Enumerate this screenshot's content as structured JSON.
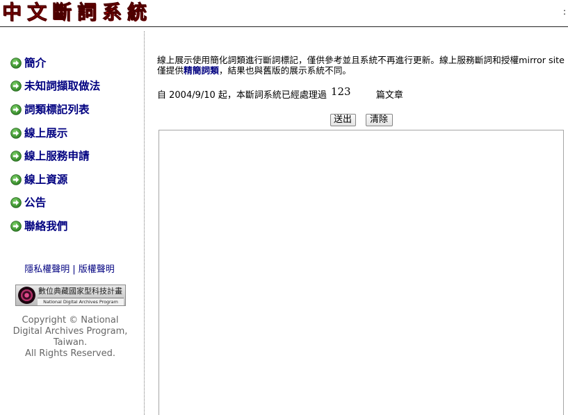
{
  "header": {
    "title": "中文斷詞系統",
    "corner_text": ":"
  },
  "sidebar": {
    "nav_icon": "green-arrow-circle-icon",
    "items": [
      {
        "label": "簡介"
      },
      {
        "label": "未知詞擷取做法"
      },
      {
        "label": "詞類標記列表"
      },
      {
        "label": "線上展示"
      },
      {
        "label": "線上服務申請"
      },
      {
        "label": "線上資源"
      },
      {
        "label": "公告"
      },
      {
        "label": "聯絡我們"
      }
    ],
    "legal_links": {
      "privacy": "隱私權聲明",
      "separator": "|",
      "copyright": "版權聲明"
    },
    "logo": {
      "title": "數位典藏國家型科技計畫",
      "subtitle": "National Digital Archives Program"
    },
    "copyright_lines": [
      "Copyright © National",
      "Digital Archives Program,",
      "Taiwan.",
      "All Rights Reserved."
    ]
  },
  "main": {
    "notice": {
      "before": "線上展示使用簡化詞類進行斷詞標記，僅供參考並且系統不再進行更新。線上服務斷詞和授權mirror site僅提供",
      "emphasis": "精簡詞類",
      "after": "，結果也與舊版的展示系統不同。"
    },
    "stats": {
      "prefix": "自 2004/9/10 起，本斷詞系統已經處理過",
      "count": "123",
      "suffix": "篇文章"
    },
    "buttons": {
      "submit": "送出",
      "clear": "清除"
    }
  },
  "colors": {
    "title_red": "#d80000",
    "nav_text": "#000080",
    "copyright_text": "#666666",
    "icon_green": "#3c9b2e",
    "rule": "#222222"
  }
}
